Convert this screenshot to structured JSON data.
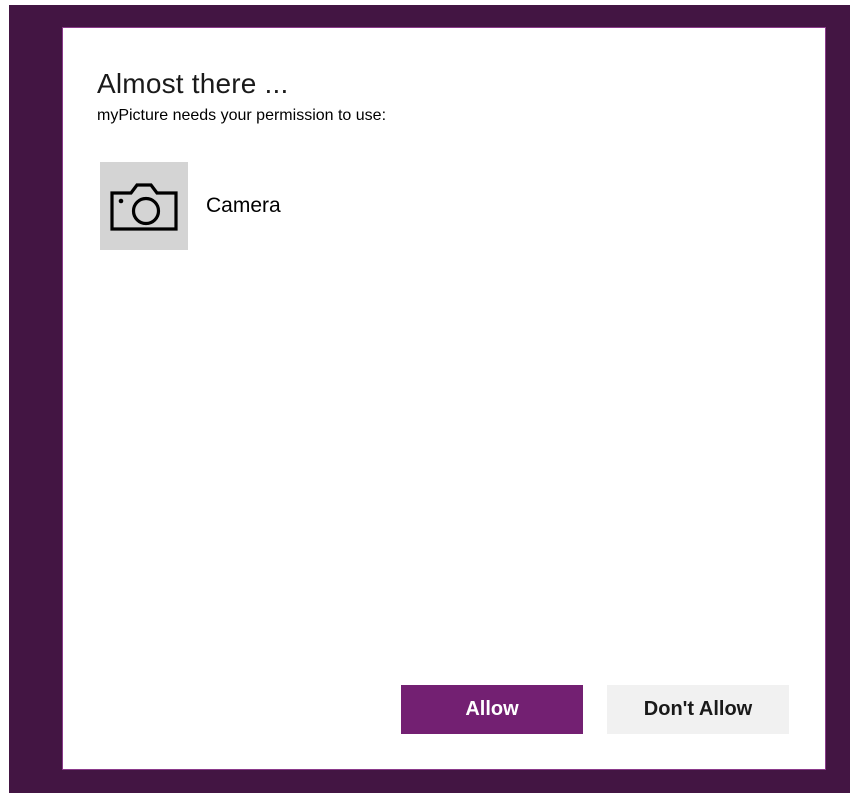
{
  "dialog": {
    "title": "Almost there ...",
    "subtitle": "myPicture needs your permission to use:",
    "permissions": [
      {
        "label": "Camera",
        "icon": "camera-icon"
      }
    ],
    "buttons": {
      "allow_label": "Allow",
      "deny_label": "Don't Allow"
    }
  },
  "colors": {
    "frame": "#431543",
    "accent": "#732072",
    "icon_tile": "#d4d4d4",
    "secondary_button": "#f1f1f1"
  }
}
